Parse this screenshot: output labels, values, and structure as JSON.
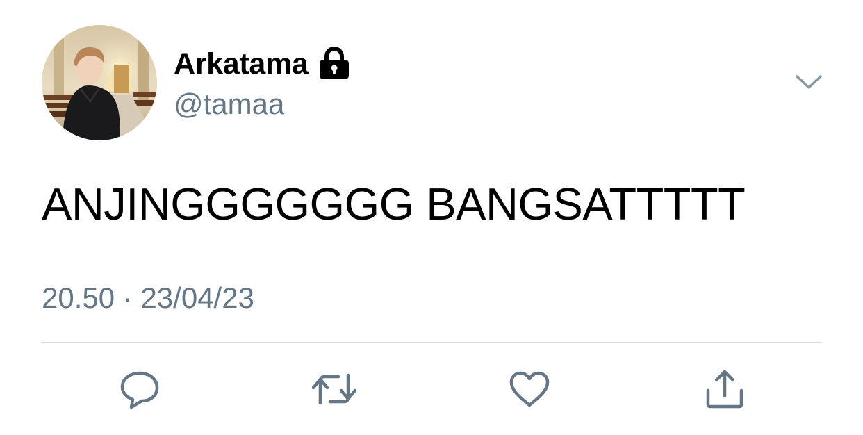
{
  "tweet": {
    "author": {
      "display_name": "Arkatama",
      "handle": "@tamaa",
      "protected_icon": "lock-icon",
      "avatar": "profile-photo"
    },
    "text": "ANJINGGGGGGG BANGSATTTTT",
    "time": "20.50",
    "separator": "·",
    "date": "23/04/23",
    "menu_icon": "chevron-down-icon"
  },
  "actions": [
    {
      "name": "reply",
      "icon": "speech-bubble-icon"
    },
    {
      "name": "retweet",
      "icon": "retweet-arrows-icon"
    },
    {
      "name": "like",
      "icon": "heart-icon"
    },
    {
      "name": "share",
      "icon": "share-upload-icon"
    }
  ],
  "colors": {
    "text_primary": "#000000",
    "text_secondary": "#657786",
    "divider": "#d9dde0",
    "icon": "#657786"
  }
}
